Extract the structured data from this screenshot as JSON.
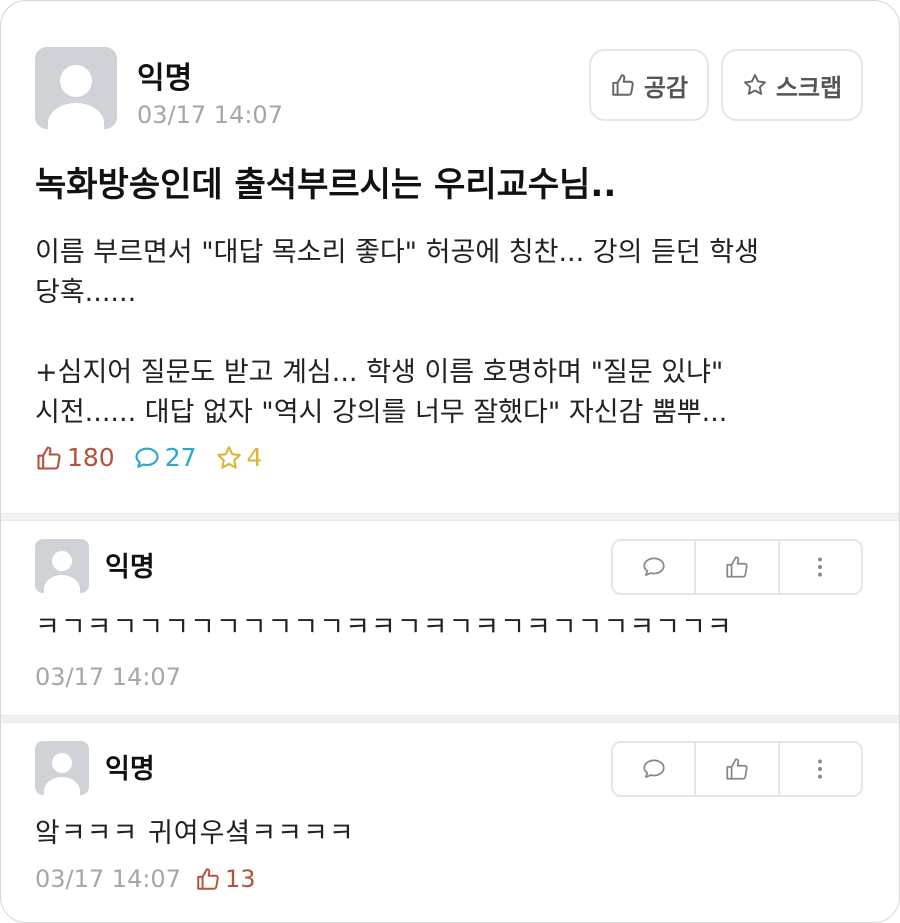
{
  "post": {
    "author": "익명",
    "date": "03/17 14:07",
    "like_button_label": "공감",
    "scrap_button_label": "스크랩",
    "title": "녹화방송인데 출석부르시는 우리교수님..",
    "body_lines": [
      "이름 부르면서 \"대답 목소리 좋다\" 허공에 칭찬... 강의 듣던 학생",
      "당혹......",
      "",
      "+심지어 질문도 받고 계심... 학생 이름 호명하며 \"질문 있냐\"",
      "시전...... 대답 없자 \"역시 강의를 너무 잘했다\" 자신감 뿜뿌..."
    ],
    "stats": {
      "likes": "180",
      "comments": "27",
      "scraps": "4"
    }
  },
  "comments": [
    {
      "author": "익명",
      "text": "ㅋㄱㅋㄱㄱㄱㄱㄱㄱㄱㄱㄱㅋㅋㄱㅋㄱㅋㄱㅋㄱㄱㄱㅋㄱㄱㅋ",
      "date": "03/17 14:07",
      "likes": ""
    },
    {
      "author": "익명",
      "text": "앜ㅋㅋㅋ 귀여우셬ㅋㅋㅋㅋ",
      "date": "03/17 14:07",
      "likes": "13"
    }
  ],
  "icons": {
    "thumbs_up": "thumbs-up-icon",
    "star": "star-icon",
    "speech_bubble": "speech-bubble-icon",
    "more": "more-vertical-icon"
  },
  "colors": {
    "like_accent": "#b5523e",
    "comment_accent": "#2aa7c9",
    "scrap_accent": "#dcb634",
    "muted_text": "#a6a6a6"
  }
}
